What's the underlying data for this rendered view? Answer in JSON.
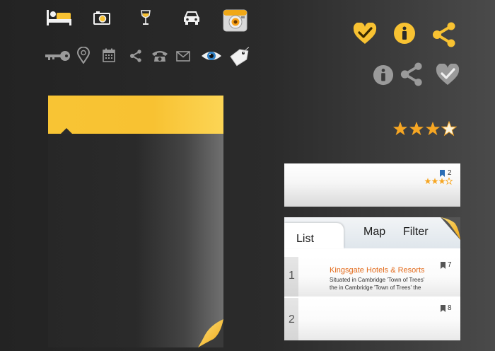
{
  "icons_top_white": [
    "hotel-bed-icon",
    "camera-icon",
    "wine-glass-icon",
    "car-icon",
    "photo-camera-app-icon"
  ],
  "icons_top_grey": [
    "key-icon",
    "location-pin-icon",
    "calendar-icon",
    "share-icon",
    "phone-icon",
    "mail-icon",
    "eye-icon",
    "price-tag-icon"
  ],
  "icons_big_yellow": [
    "heart-check-icon",
    "info-icon",
    "share-icon"
  ],
  "icons_big_grey": [
    "info-icon",
    "share-icon",
    "heart-check-icon"
  ],
  "colors": {
    "accent": "#f8c232",
    "accent_dark": "#f0a817",
    "title_orange": "#e36b1c",
    "bookmark_blue": "#2a6db5",
    "icon_grey": "#9a9a9a"
  },
  "rating": {
    "value": 4,
    "max": 4
  },
  "card1": {
    "bookmark_count": "2",
    "rating": {
      "value": 3,
      "max": 4
    }
  },
  "list": {
    "tabs": {
      "list": "List",
      "map": "Map",
      "filter": "Filter"
    },
    "rows": [
      {
        "number": "1",
        "bookmark_count": "7",
        "title": "Kingsgate Hotels & Resorts",
        "desc_line1": "Situated in Cambridge 'Town of Trees'",
        "desc_line2": "the in Cambridge 'Town of Trees' the"
      },
      {
        "number": "2",
        "bookmark_count": "8",
        "title": "",
        "desc_line1": "",
        "desc_line2": ""
      }
    ]
  }
}
